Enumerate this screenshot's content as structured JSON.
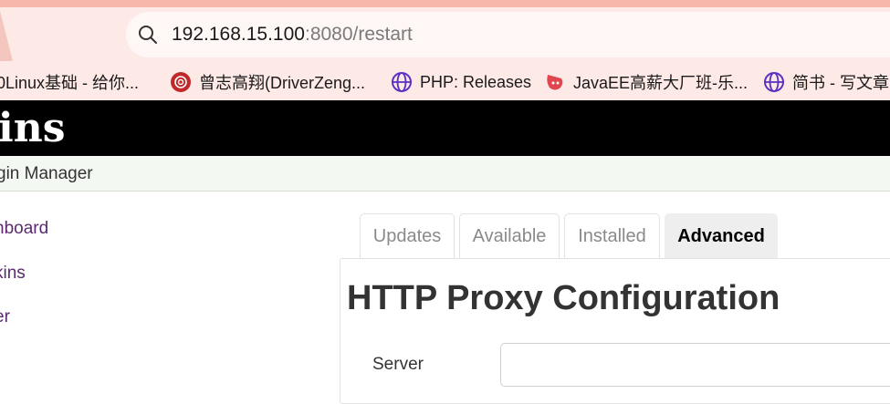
{
  "browser": {
    "address": {
      "host": "192.168.15.100",
      "rest": ":8080/restart"
    },
    "bookmarks": [
      {
        "label": "0Linux基础 - 给你...",
        "icon": "linux-site-icon"
      },
      {
        "label": "曾志高翔(DriverZeng...",
        "icon": "red-rose-icon"
      },
      {
        "label": "PHP: Releases",
        "icon": "globe-icon"
      },
      {
        "label": "JavaEE高薪大厂班-乐...",
        "icon": "bilibili-icon"
      },
      {
        "label": "简书 - 写文章",
        "icon": "globe-icon"
      }
    ]
  },
  "jenkins": {
    "logo": "ins",
    "breadcrumb": "gin Manager",
    "side_items": [
      "nboard",
      "kins",
      "er"
    ],
    "tabs": [
      "Updates",
      "Available",
      "Installed",
      "Advanced"
    ],
    "active_tab": "Advanced",
    "section_title": "HTTP Proxy Configuration",
    "server_label": "Server",
    "server_value": ""
  },
  "colors": {
    "chrome_bg": "#fde9e5",
    "jenkins_header": "#000000",
    "side_link": "#5b2a6e"
  }
}
